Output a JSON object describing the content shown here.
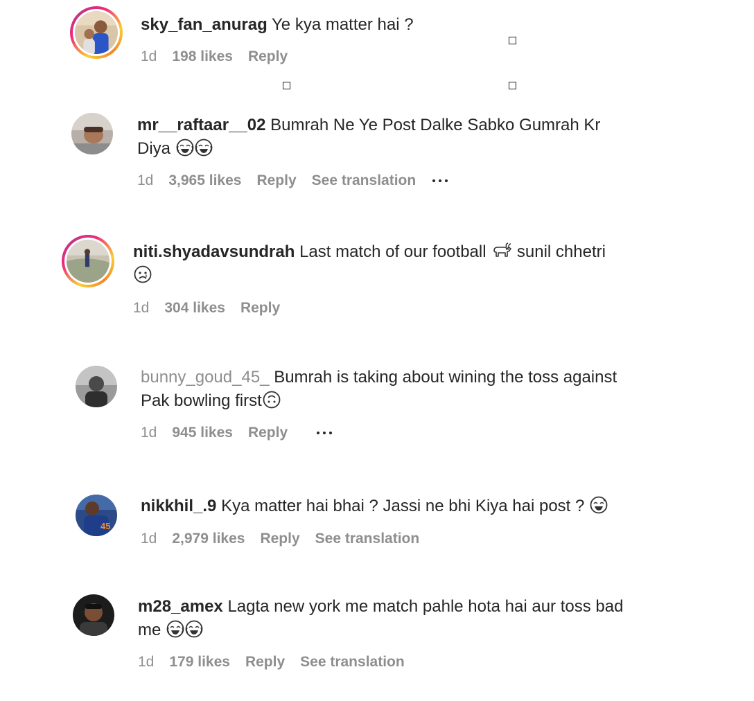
{
  "comments": [
    {
      "username": "sky_fan_anurag",
      "text": "Ye kya matter hai ?",
      "time": "1d",
      "likes": "198 likes",
      "reply": "Reply"
    },
    {
      "username": "mr__raftaar__02",
      "text": "Bumrah Ne Ye Post Dalke Sabko Gumrah Kr Diya",
      "time": "1d",
      "likes": "3,965 likes",
      "reply": "Reply",
      "translation": "See translation"
    },
    {
      "username": "niti.shyadavsundrah",
      "text": "Last match of our football",
      "text_after": " sunil chhetri",
      "time": "1d",
      "likes": "304 likes",
      "reply": "Reply"
    },
    {
      "username": "bunny_goud_45_",
      "text": "Bumrah is taking about wining the toss against Pak bowling first",
      "time": "1d",
      "likes": "945 likes",
      "reply": "Reply"
    },
    {
      "username": "nikkhil_.9",
      "text": "Kya matter hai bhai ? Jassi ne bhi Kiya hai post ?",
      "time": "1d",
      "likes": "2,979 likes",
      "reply": "Reply",
      "translation": "See translation"
    },
    {
      "username": "m28_amex",
      "text": "Lagta new york me match pahle hota hai aur toss bad me",
      "time": "1d",
      "likes": "179 likes",
      "reply": "Reply",
      "translation": "See translation"
    }
  ],
  "colors": {
    "text": "#262626",
    "muted": "#8e8e8e",
    "story_ring_start": "#f9ce34",
    "story_ring_mid": "#ee2a7b",
    "story_ring_end": "#c13584"
  },
  "icons": {
    "more": "more-horizontal-icon",
    "laughing": "face-with-tears-of-joy-emoji",
    "goat": "goat-emoji",
    "crying": "crying-face-emoji",
    "upside_down": "upside-down-face-emoji",
    "sweat_smile": "grinning-face-with-sweat-emoji"
  }
}
